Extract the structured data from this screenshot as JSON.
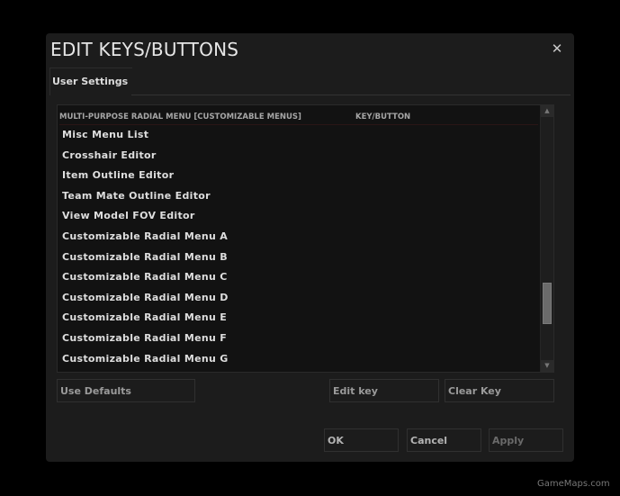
{
  "dialog": {
    "title": "EDIT KEYS/BUTTONS",
    "close_icon": "close-icon",
    "tabs": [
      {
        "label": "User Settings",
        "active": true
      }
    ]
  },
  "list": {
    "columns": [
      "MULTI-PURPOSE RADIAL MENU [CUSTOMIZABLE MENUS]",
      "KEY/BUTTON"
    ],
    "rows": [
      {
        "name": "Misc Menu List",
        "key": ""
      },
      {
        "name": "Crosshair Editor",
        "key": ""
      },
      {
        "name": "Item Outline Editor",
        "key": ""
      },
      {
        "name": "Team Mate Outline Editor",
        "key": ""
      },
      {
        "name": "View Model FOV Editor",
        "key": ""
      },
      {
        "name": "Customizable Radial Menu A",
        "key": ""
      },
      {
        "name": "Customizable Radial Menu B",
        "key": ""
      },
      {
        "name": "Customizable Radial Menu C",
        "key": ""
      },
      {
        "name": "Customizable Radial Menu D",
        "key": ""
      },
      {
        "name": "Customizable Radial Menu E",
        "key": ""
      },
      {
        "name": "Customizable Radial Menu F",
        "key": ""
      },
      {
        "name": "Customizable Radial Menu G",
        "key": ""
      }
    ],
    "scroll": {
      "position_fraction": 0.82,
      "visible_fraction": 0.17,
      "up_icon": "scroll-up-arrow-icon",
      "down_icon": "scroll-down-arrow-icon"
    }
  },
  "actions": {
    "use_defaults": "Use Defaults",
    "edit_key": "Edit key",
    "clear_key": "Clear Key"
  },
  "footer": {
    "ok": "OK",
    "cancel": "Cancel",
    "apply": "Apply",
    "apply_enabled": false
  },
  "watermark": "GameMaps.com",
  "colors": {
    "background": "#000000",
    "dialog": "#1c1c1c",
    "list_bg": "#121212",
    "text": "#dedede",
    "header_text": "#a6a6a6",
    "scroll_thumb": "#6b6b6b"
  }
}
